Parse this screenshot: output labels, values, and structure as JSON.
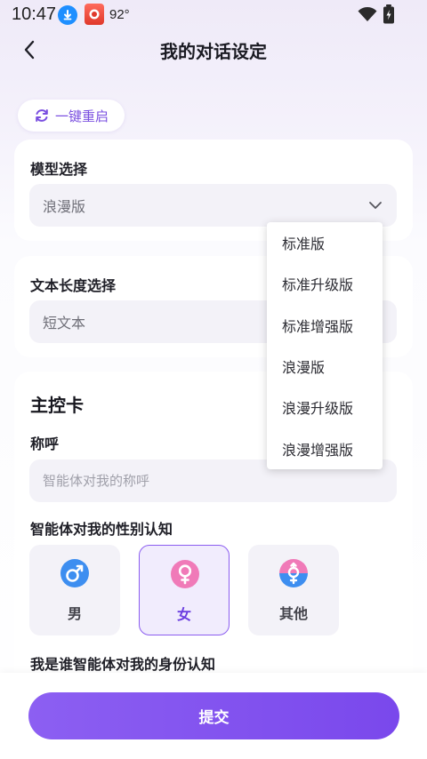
{
  "status_bar": {
    "time": "10:47",
    "temperature": "92°"
  },
  "header": {
    "title": "我的对话设定"
  },
  "reset": {
    "label": "一键重启"
  },
  "model": {
    "label": "模型选择",
    "value": "浪漫版",
    "options": [
      "标准版",
      "标准升级版",
      "标准增强版",
      "浪漫版",
      "浪漫升级版",
      "浪漫增强版"
    ]
  },
  "text_length": {
    "label": "文本长度选择",
    "value": "短文本"
  },
  "main_card": {
    "title": "主控卡",
    "nickname_label": "称呼",
    "nickname_placeholder": "智能体对我的称呼",
    "gender_label": "智能体对我的性别认知",
    "gender_options": [
      {
        "label": "男",
        "icon": "male-icon",
        "color": "#3d8ef0"
      },
      {
        "label": "女",
        "icon": "female-icon",
        "color": "#f07ab8"
      },
      {
        "label": "其他",
        "icon": "transgender-icon",
        "color": "#e86aa8"
      }
    ],
    "gender_selected": "女",
    "identity_label": "我是谁智能体对我的身份认知"
  },
  "submit": {
    "label": "提交"
  },
  "colors": {
    "accent": "#7a48ec",
    "accent_light": "#f1ecfd",
    "male": "#3d8ef0",
    "female": "#f07ab8"
  }
}
